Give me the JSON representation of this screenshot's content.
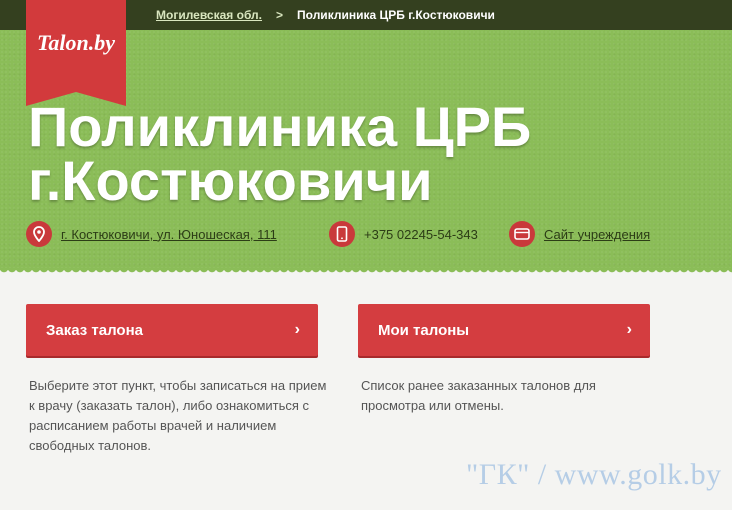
{
  "breadcrumb": {
    "region": "Могилевская обл.",
    "separator": ">",
    "current": "Поликлиника ЦРБ г.Костюковичи"
  },
  "logo": {
    "text": "Talon.by"
  },
  "header": {
    "title_line1": "Поликлиника ЦРБ",
    "title_line2": "г.Костюковичи"
  },
  "contacts": {
    "address": {
      "icon": "map-pin-icon",
      "text": "г. Костюковичи, ул. Юношеская, 111"
    },
    "phone": {
      "icon": "phone-icon",
      "text": "+375 02245-54-343"
    },
    "website": {
      "icon": "browser-icon",
      "text": "Сайт учреждения"
    }
  },
  "actions": {
    "order": {
      "label": "Заказ талона",
      "chevron": "›",
      "description": "Выберите этот пункт, чтобы записаться на прием к врачу (заказать талон), либо ознакомиться с расписанием работы врачей и наличием свободных талонов."
    },
    "my": {
      "label": "Мои талоны",
      "chevron": "›",
      "description": "Список ранее заказанных талонов для просмотра или отмены."
    }
  },
  "watermark": "\"ГК\" / www.golk.by",
  "colors": {
    "header_green": "#8bbd58",
    "topbar": "#34401f",
    "accent_red": "#d43d40"
  }
}
